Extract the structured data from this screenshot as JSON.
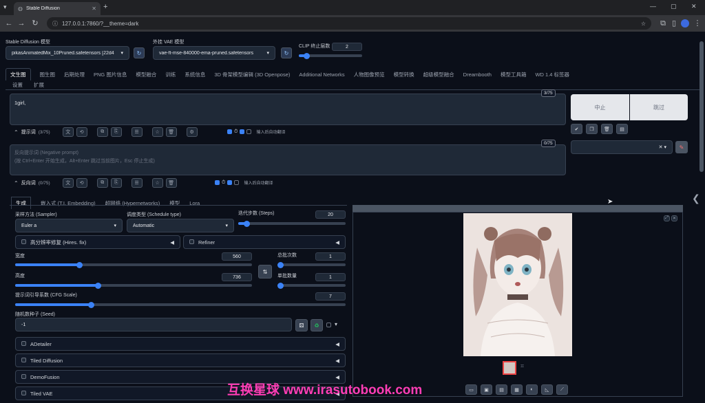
{
  "browser": {
    "tab_title": "Stable Diffusion",
    "url": "127.0.0.1:7860/?__theme=dark"
  },
  "header": {
    "checkpoint_label": "Stable Diffusion 模型",
    "checkpoint_value": "pikasAnimatedMix_10Pruned.safetensors [22d4",
    "vae_label": "外挂 VAE 模型",
    "vae_value": "vae-ft-mse-840000-ema-pruned.safetensors",
    "clip_label": "CLIP 终止层数",
    "clip_value": "2"
  },
  "main_tabs": [
    "文生图",
    "图生图",
    "后期处理",
    "PNG 图片信息",
    "模型融合",
    "训练",
    "系统信息",
    "3D 骨架模型编辑 (3D Openpose)",
    "Additional Networks",
    "人物图像预览",
    "模型转换",
    "超级模型融合",
    "Dreambooth",
    "模型工具箱",
    "WD 1.4 标签器"
  ],
  "main_tabs_row2": [
    "设置",
    "扩展"
  ],
  "prompt": {
    "text": "1girl,",
    "counter": "3/75",
    "toolbar_label": "提示词",
    "toolbar_count": "(3/75)",
    "translate_hint": "输入后自动翻译"
  },
  "negative": {
    "placeholder_1": "反向提示词 (Negative prompt)",
    "placeholder_2": "(按 Ctrl+Enter 开始生成，Alt+Enter 跳过当前图片，Esc 停止生成)",
    "counter": "0/75",
    "toolbar_label": "反向词",
    "toolbar_count": "(0/75)",
    "translate_hint": "输入后自动翻译"
  },
  "generate": {
    "interrupt": "中止",
    "skip": "跳过"
  },
  "sub_tabs": [
    "生成",
    "嵌入式 (T.I. Embedding)",
    "超网络 (Hypernetworks)",
    "模型",
    "Lora"
  ],
  "params": {
    "sampler_label": "采样方法 (Sampler)",
    "sampler_value": "Euler a",
    "schedule_label": "调度类型 (Schedule type)",
    "schedule_value": "Automatic",
    "steps_label": "迭代步数 (Steps)",
    "steps_value": "20",
    "hires_label": "高分辨率修复 (Hires. fix)",
    "refiner_label": "Refiner",
    "width_label": "宽度",
    "width_value": "560",
    "height_label": "高度",
    "height_value": "736",
    "batch_count_label": "总批次数",
    "batch_count_value": "1",
    "batch_size_label": "单批数量",
    "batch_size_value": "1",
    "cfg_label": "提示词引导系数 (CFG Scale)",
    "cfg_value": "7",
    "seed_label": "随机数种子 (Seed)",
    "seed_value": "-1"
  },
  "progress": {
    "steps_fraction": 0.08,
    "width_fraction": 0.27,
    "height_fraction": 0.35,
    "cfg_fraction": 0.23,
    "clip_fraction": 0.12
  },
  "accordions": [
    "ADetailer",
    "Tiled Diffusion",
    "DemoFusion",
    "Tiled VAE"
  ],
  "watermark": "互换星球 www.irasutobook.com",
  "colors": {
    "accent": "#3b82f6",
    "background": "#0b0f19",
    "panel": "#1f2937",
    "watermark": "#ff3db5"
  }
}
